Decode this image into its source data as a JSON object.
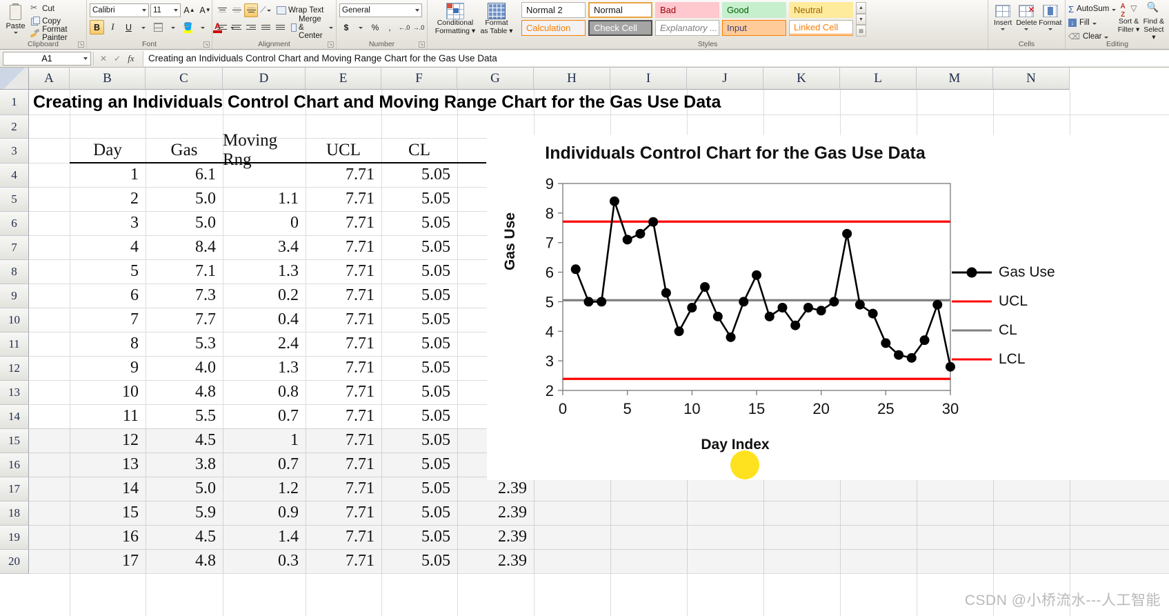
{
  "ribbon": {
    "groups": {
      "clipboard": {
        "label": "Clipboard",
        "paste": "Paste",
        "items": [
          {
            "label": "Cut",
            "icon": "scissors-icon"
          },
          {
            "label": "Copy",
            "icon": "copy-icon"
          },
          {
            "label": "Format Painter",
            "icon": "format-painter-icon"
          }
        ]
      },
      "font": {
        "label": "Font",
        "font_name": "Calibri",
        "font_size": "11",
        "grow_font": "A",
        "shrink_font": "A",
        "bold": "B",
        "italic": "I",
        "underline": "U",
        "borders_icon": "borders-icon",
        "fill_color_icon": "fill-color-icon",
        "font_color_icon": "font-color-icon"
      },
      "alignment": {
        "label": "Alignment",
        "wrap_text": "Wrap Text",
        "merge_center": "Merge & Center",
        "top_align_icon": "align-top-icon",
        "middle_align_icon": "align-middle-icon",
        "bottom_align_icon": "align-bottom-icon",
        "orientation_icon": "orientation-icon",
        "align_left_icon": "align-left-icon",
        "align_center_icon": "align-center-icon",
        "align_right_icon": "align-right-icon",
        "decrease_indent_icon": "decrease-indent-icon",
        "increase_indent_icon": "increase-indent-icon"
      },
      "number": {
        "label": "Number",
        "format": "General",
        "currency": "$",
        "percent": "%",
        "comma": ",",
        "increase_decimal": ".00",
        "decrease_decimal": ".00"
      },
      "styles": {
        "label": "Styles",
        "conditional_formatting": "Conditional\nFormatting",
        "conditional_formatting_l1": "Conditional",
        "conditional_formatting_l2": "Formatting",
        "format_as_table_l1": "Format",
        "format_as_table_l2": "as Table",
        "cells": [
          [
            {
              "label": "Normal 2",
              "bg": "#ffffff",
              "fg": "#1a1a1a",
              "selected": false
            },
            {
              "label": "Normal",
              "bg": "#ffffff",
              "fg": "#1a1a1a",
              "selected": true
            },
            {
              "label": "Bad",
              "bg": "#ffc7ce",
              "fg": "#9c0006",
              "selected": false
            },
            {
              "label": "Good",
              "bg": "#c6efce",
              "fg": "#006100",
              "selected": false
            },
            {
              "label": "Neutral",
              "bg": "#ffeb9c",
              "fg": "#9c6500",
              "selected": false
            }
          ],
          [
            {
              "label": "Calculation",
              "bg": "#f2f2f2",
              "fg": "#fa7d00",
              "selected": false
            },
            {
              "label": "Check Cell",
              "bg": "#a5a5a5",
              "fg": "#ffffff",
              "selected": false
            },
            {
              "label": "Explanatory ...",
              "bg": "#ffffff",
              "fg": "#7f7f7f",
              "selected": false
            },
            {
              "label": "Input",
              "bg": "#ffcc99",
              "fg": "#3f3f76",
              "selected": false
            },
            {
              "label": "Linked Cell",
              "bg": "#ffffff",
              "fg": "#fa7d00",
              "selected": false
            }
          ]
        ]
      },
      "cells": {
        "label": "Cells",
        "items": [
          {
            "label": "Insert",
            "icon": "insert-cells-icon"
          },
          {
            "label": "Delete",
            "icon": "delete-cells-icon"
          },
          {
            "label": "Format",
            "icon": "format-cells-icon"
          }
        ]
      },
      "editing": {
        "label": "Editing",
        "autosum": "AutoSum",
        "fill": "Fill",
        "clear": "Clear",
        "sort_filter_l1": "Sort &",
        "sort_filter_l2": "Filter",
        "find_select_l1": "Find &",
        "find_select_l2": "Select"
      }
    }
  },
  "formula_bar": {
    "name_box": "A1",
    "formula": "Creating an Individuals Control Chart and Moving Range Chart for the Gas Use Data",
    "cancel_icon": "cancel-icon",
    "enter_icon": "enter-icon",
    "fx_icon": "insert-function-icon"
  },
  "grid": {
    "columns": [
      "A",
      "B",
      "C",
      "D",
      "E",
      "F",
      "G",
      "H",
      "I",
      "J",
      "K",
      "L",
      "M",
      "N"
    ],
    "rows": [
      "1",
      "2",
      "3",
      "4",
      "5",
      "6",
      "7",
      "8",
      "9",
      "10",
      "11",
      "12",
      "13",
      "14",
      "15",
      "16",
      "17",
      "18",
      "19",
      "20"
    ],
    "title_cell": "Creating an Individuals Control Chart and Moving Range Chart for the Gas Use Data",
    "headers": {
      "B": "Day",
      "C": "Gas",
      "D": "Moving Rng",
      "E": "UCL",
      "F": "CL"
    },
    "data": [
      {
        "row": "4",
        "day": "1",
        "gas": "6.1",
        "mr": "",
        "ucl": "7.71",
        "cl": "5.05",
        "lcl": ""
      },
      {
        "row": "5",
        "day": "2",
        "gas": "5.0",
        "mr": "1.1",
        "ucl": "7.71",
        "cl": "5.05",
        "lcl": ""
      },
      {
        "row": "6",
        "day": "3",
        "gas": "5.0",
        "mr": "0",
        "ucl": "7.71",
        "cl": "5.05",
        "lcl": ""
      },
      {
        "row": "7",
        "day": "4",
        "gas": "8.4",
        "mr": "3.4",
        "ucl": "7.71",
        "cl": "5.05",
        "lcl": ""
      },
      {
        "row": "8",
        "day": "5",
        "gas": "7.1",
        "mr": "1.3",
        "ucl": "7.71",
        "cl": "5.05",
        "lcl": ""
      },
      {
        "row": "9",
        "day": "6",
        "gas": "7.3",
        "mr": "0.2",
        "ucl": "7.71",
        "cl": "5.05",
        "lcl": ""
      },
      {
        "row": "10",
        "day": "7",
        "gas": "7.7",
        "mr": "0.4",
        "ucl": "7.71",
        "cl": "5.05",
        "lcl": ""
      },
      {
        "row": "11",
        "day": "8",
        "gas": "5.3",
        "mr": "2.4",
        "ucl": "7.71",
        "cl": "5.05",
        "lcl": ""
      },
      {
        "row": "12",
        "day": "9",
        "gas": "4.0",
        "mr": "1.3",
        "ucl": "7.71",
        "cl": "5.05",
        "lcl": ""
      },
      {
        "row": "13",
        "day": "10",
        "gas": "4.8",
        "mr": "0.8",
        "ucl": "7.71",
        "cl": "5.05",
        "lcl": ""
      },
      {
        "row": "14",
        "day": "11",
        "gas": "5.5",
        "mr": "0.7",
        "ucl": "7.71",
        "cl": "5.05",
        "lcl": ""
      },
      {
        "row": "15",
        "day": "12",
        "gas": "4.5",
        "mr": "1",
        "ucl": "7.71",
        "cl": "5.05",
        "lcl": ""
      },
      {
        "row": "16",
        "day": "13",
        "gas": "3.8",
        "mr": "0.7",
        "ucl": "7.71",
        "cl": "5.05",
        "lcl": ""
      },
      {
        "row": "17",
        "day": "14",
        "gas": "5.0",
        "mr": "1.2",
        "ucl": "7.71",
        "cl": "5.05",
        "lcl": "2.39"
      },
      {
        "row": "18",
        "day": "15",
        "gas": "5.9",
        "mr": "0.9",
        "ucl": "7.71",
        "cl": "5.05",
        "lcl": "2.39"
      },
      {
        "row": "19",
        "day": "16",
        "gas": "4.5",
        "mr": "1.4",
        "ucl": "7.71",
        "cl": "5.05",
        "lcl": "2.39"
      },
      {
        "row": "20",
        "day": "17",
        "gas": "4.8",
        "mr": "0.3",
        "ucl": "7.71",
        "cl": "5.05",
        "lcl": "2.39"
      }
    ]
  },
  "chart_data": {
    "type": "line",
    "title": "Individuals Control Chart for the Gas Use Data",
    "xlabel": "Day Index",
    "ylabel": "Gas Use",
    "xlim": [
      0,
      30
    ],
    "ylim": [
      2,
      9
    ],
    "xticks": [
      0,
      5,
      10,
      15,
      20,
      25,
      30
    ],
    "yticks": [
      2,
      3,
      4,
      5,
      6,
      7,
      8,
      9
    ],
    "grid": false,
    "legend_position": "right",
    "x": [
      1,
      2,
      3,
      4,
      5,
      6,
      7,
      8,
      9,
      10,
      11,
      12,
      13,
      14,
      15,
      16,
      17,
      18,
      19,
      20,
      21,
      22,
      23,
      24,
      25,
      26,
      27,
      28,
      29,
      30
    ],
    "series": [
      {
        "name": "Gas Use",
        "color": "#000000",
        "marker": "circle",
        "values": [
          6.1,
          5.0,
          5.0,
          8.4,
          7.1,
          7.3,
          7.7,
          5.3,
          4.0,
          4.8,
          5.5,
          4.5,
          3.8,
          5.0,
          5.9,
          4.5,
          4.8,
          4.2,
          4.8,
          4.7,
          5.0,
          7.3,
          4.9,
          4.6,
          3.6,
          3.2,
          3.1,
          3.7,
          4.9,
          2.8
        ]
      },
      {
        "name": "UCL",
        "color": "#ff0000",
        "type": "constant",
        "value": 7.71
      },
      {
        "name": "CL",
        "color": "#7f7f7f",
        "type": "constant",
        "value": 5.05
      },
      {
        "name": "LCL",
        "color": "#ff0000",
        "type": "constant",
        "value": 2.39
      }
    ]
  },
  "watermark": "CSDN @小桥流水---人工智能"
}
